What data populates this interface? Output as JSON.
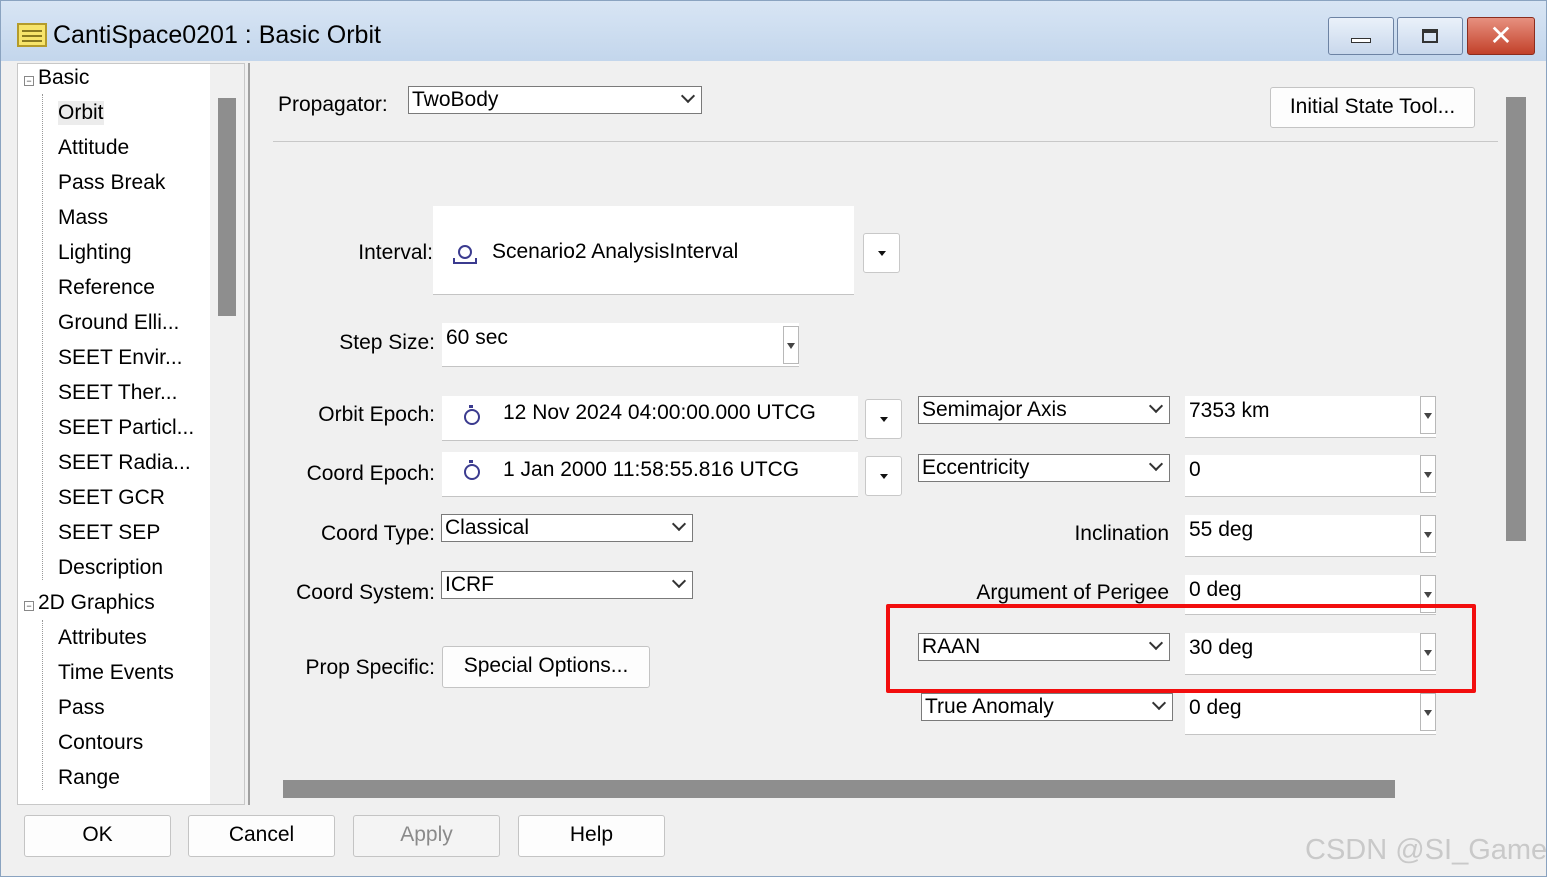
{
  "window": {
    "title": "CantiSpace0201 : Basic Orbit",
    "close_glyph": "✕"
  },
  "tree": {
    "items": [
      {
        "label": "Basic",
        "expander": "−"
      },
      {
        "label": "Orbit"
      },
      {
        "label": "Attitude"
      },
      {
        "label": "Pass Break"
      },
      {
        "label": "Mass"
      },
      {
        "label": "Lighting"
      },
      {
        "label": "Reference"
      },
      {
        "label": "Ground Elli..."
      },
      {
        "label": "SEET Envir..."
      },
      {
        "label": "SEET Ther..."
      },
      {
        "label": "SEET Particl..."
      },
      {
        "label": "SEET Radia..."
      },
      {
        "label": "SEET GCR"
      },
      {
        "label": "SEET SEP"
      },
      {
        "label": "Description"
      },
      {
        "label": "2D Graphics",
        "expander": "−"
      },
      {
        "label": "Attributes"
      },
      {
        "label": "Time Events"
      },
      {
        "label": "Pass"
      },
      {
        "label": "Contours"
      },
      {
        "label": "Range"
      }
    ]
  },
  "form": {
    "propagator_label": "Propagator:",
    "propagator_value": "TwoBody",
    "initial_state_tool": "Initial State Tool...",
    "interval_label": "Interval:",
    "interval_value": "Scenario2 AnalysisInterval",
    "step_size_label": "Step Size:",
    "step_size_value": "60 sec",
    "orbit_epoch_label": "Orbit Epoch:",
    "orbit_epoch_value": "12 Nov 2024 04:00:00.000 UTCG",
    "coord_epoch_label": "Coord Epoch:",
    "coord_epoch_value": "1 Jan 2000 11:58:55.816 UTCG",
    "coord_type_label": "Coord Type:",
    "coord_type_value": "Classical",
    "coord_system_label": "Coord System:",
    "coord_system_value": "ICRF",
    "prop_specific_label": "Prop Specific:",
    "special_options": "Special Options..."
  },
  "elements": {
    "semimajor_axis_select": "Semimajor Axis",
    "semimajor_axis_value": "7353 km",
    "eccentricity_select": "Eccentricity",
    "eccentricity_value": "0",
    "inclination_label": "Inclination",
    "inclination_value": "55 deg",
    "arg_perigee_label": "Argument of Perigee",
    "arg_perigee_value": "0 deg",
    "raan_select": "RAAN",
    "raan_value": "30 deg",
    "true_anomaly_select": "True Anomaly",
    "true_anomaly_value": "0 deg"
  },
  "footer": {
    "ok": "OK",
    "cancel": "Cancel",
    "apply": "Apply",
    "help": "Help"
  },
  "watermark": "CSDN @SI_Gamer",
  "colors": {
    "highlight_border": "#f20e0e",
    "titlebar": "#c3d6ec",
    "close_button": "#c2412a"
  }
}
